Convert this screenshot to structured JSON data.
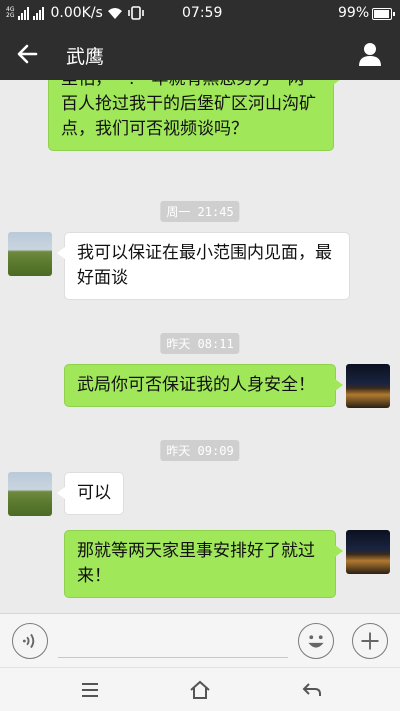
{
  "status_bar": {
    "signal_1": "4G",
    "signal_2": "2G",
    "net_speed": "0.00K/s",
    "time": "07:59",
    "battery": "99%",
    "battery_level": 0.99,
    "icons": [
      "signal-icon",
      "wifi-icon",
      "vibrate-icon",
      "battery-icon"
    ]
  },
  "header": {
    "title": "武鹰",
    "back_icon": "arrow-left-icon",
    "profile_icon": "person-icon"
  },
  "messages": [
    {
      "id": "m1",
      "direction": "out",
      "text": "里怕，一.一年就有黑恶势力一两百人抢过我干的后堡矿区河山沟矿点，我们可否视频谈吗？"
    },
    {
      "id": "t1",
      "type": "timestamp",
      "text": "周一 21:45"
    },
    {
      "id": "m2",
      "direction": "in",
      "text": "我可以保证在最小范围内见面，最好面谈"
    },
    {
      "id": "t2",
      "type": "timestamp",
      "text": "昨天 08:11"
    },
    {
      "id": "m3",
      "direction": "out",
      "text": "武局你可否保证我的人身安全！"
    },
    {
      "id": "t3",
      "type": "timestamp",
      "text": "昨天 09:09"
    },
    {
      "id": "m4",
      "direction": "in",
      "text": "可以"
    },
    {
      "id": "m5",
      "direction": "out",
      "text": "那就等两天家里事安排好了就过来！"
    }
  ],
  "input_bar": {
    "voice_icon": "voice-icon",
    "emoji_icon": "emoji-icon",
    "plus_icon": "plus-icon",
    "placeholder": ""
  },
  "nav_bar": {
    "icons": [
      "menu-icon",
      "home-icon",
      "back-icon"
    ]
  },
  "colors": {
    "header_bg": "#2e2e2e",
    "chat_bg": "#ebebeb",
    "outgoing_bubble": "#a0e75a",
    "incoming_bubble": "#ffffff"
  }
}
